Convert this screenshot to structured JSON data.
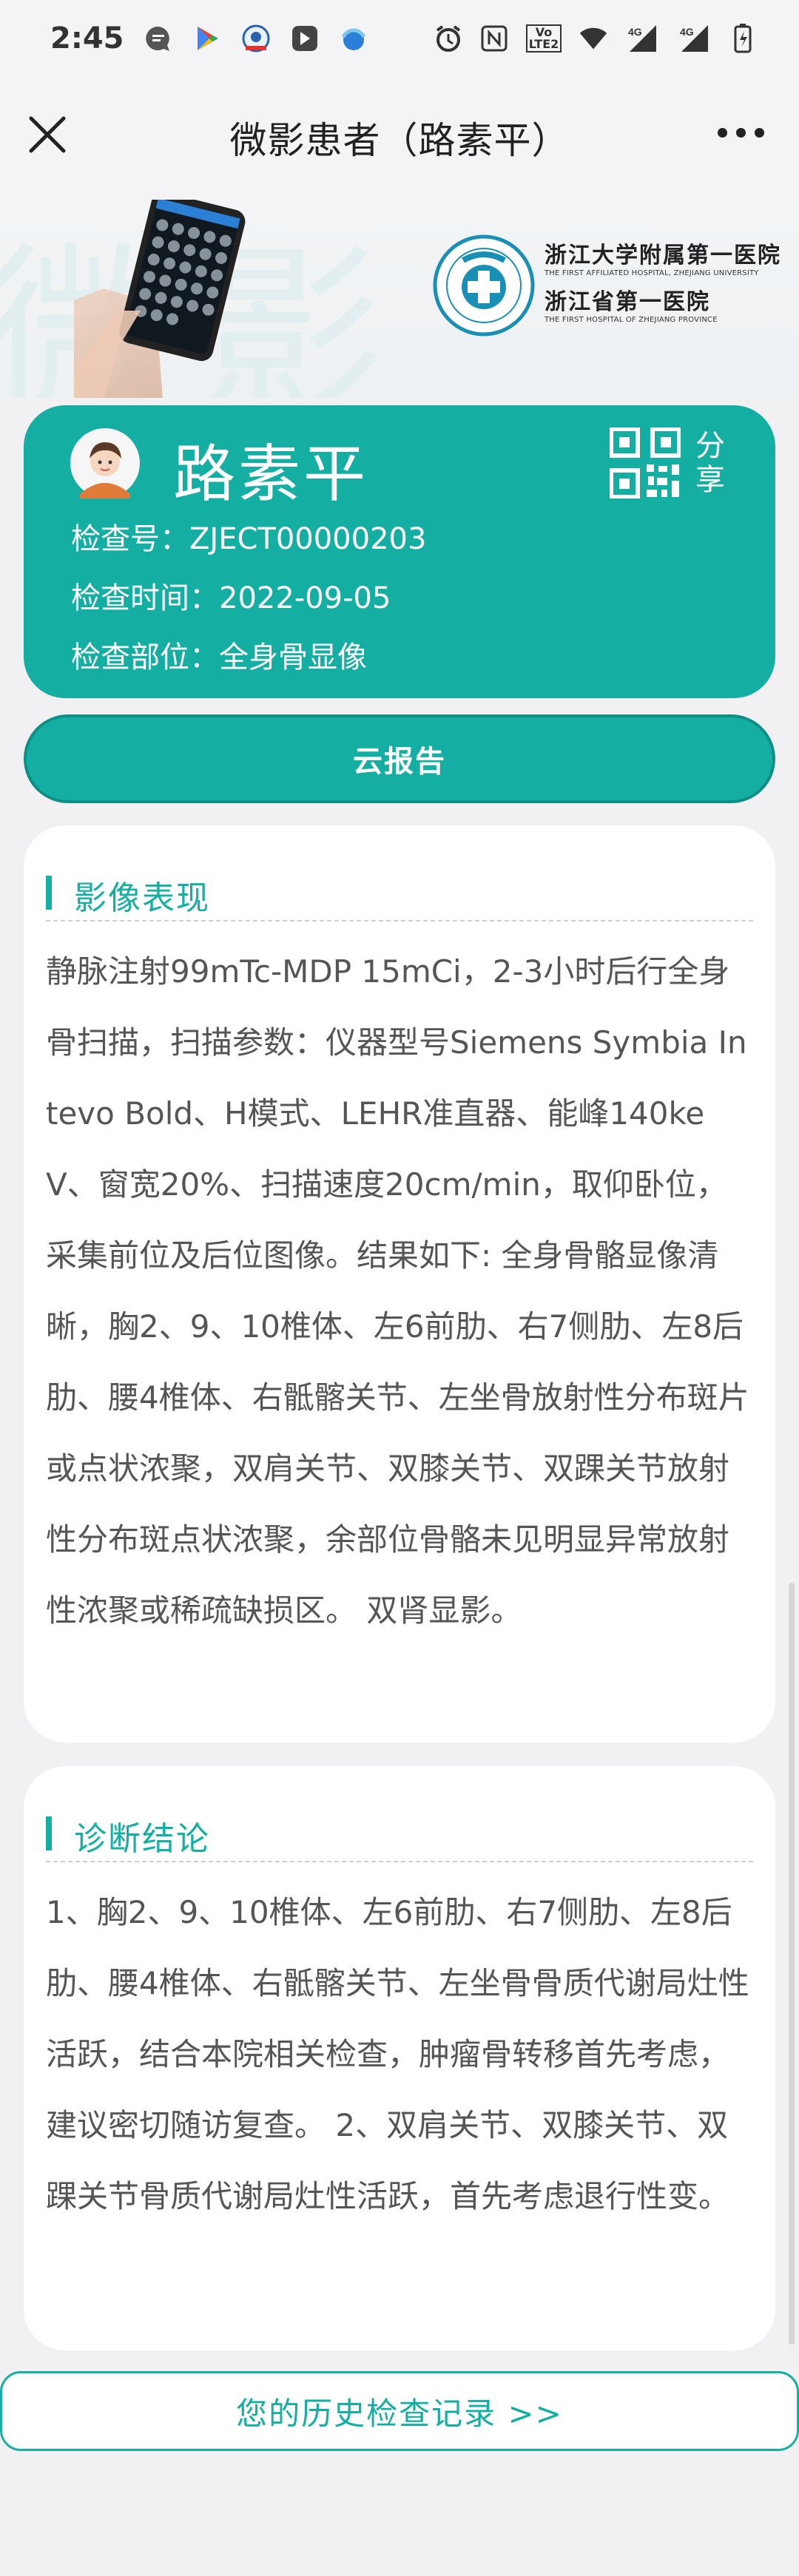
{
  "status_bar": {
    "time": "2:45",
    "volte_label_top": "Vo",
    "volte_label_bottom": "LTE2",
    "net1": "4G",
    "net2": "4G"
  },
  "nav": {
    "title": "微影患者（路素平）"
  },
  "banner": {
    "bg_text": "微影",
    "hospital_name_line1": "浙江大学附属第一医院",
    "hospital_en_line1": "THE FIRST AFFILIATED HOSPITAL, ZHEJIANG UNIVERSITY",
    "hospital_name_line2": "浙江省第一医院",
    "hospital_en_line2": "THE FIRST HOSPITAL OF ZHEJIANG PROVINCE"
  },
  "patient": {
    "name": "路素平",
    "exam_no": "检查号：ZJECT00000203",
    "exam_time": "检查时间：2022-09-05",
    "exam_part": "检查部位：全身骨显像",
    "share_label": "分享"
  },
  "report_button": "云报告",
  "imaging": {
    "title": "影像表现",
    "text": "静脉注射99mTc-MDP 15mCi，2-3小时后行全身骨扫描，扫描参数：仪器型号Siemens Symbia Intevo Bold、H模式、LEHR准直器、能峰140keV、窗宽20%、扫描速度20cm/min，取仰卧位，采集前位及后位图像。结果如下: 全身骨骼显像清晰，胸2、9、10椎体、左6前肋、右7侧肋、左8后肋、腰4椎体、右骶髂关节、左坐骨放射性分布斑片或点状浓聚，双肩关节、双膝关节、双踝关节放射性分布斑点状浓聚，余部位骨骼未见明显异常放射性浓聚或稀疏缺损区。 双肾显影。"
  },
  "diagnosis": {
    "title": "诊断结论",
    "text": "1、胸2、9、10椎体、左6前肋、右7侧肋、左8后肋、腰4椎体、右骶髂关节、左坐骨骨质代谢局灶性活跃，结合本院相关检查，肿瘤骨转移首先考虑，建议密切随访复查。 2、双肩关节、双膝关节、双踝关节骨质代谢局灶性活跃，首先考虑退行性变。"
  },
  "history_button": "您的历史检查记录 >>",
  "colors": {
    "accent": "#15aea3",
    "background": "#f1f1f3"
  },
  "icons": {
    "close": "close-icon",
    "more": "more-icon",
    "qr": "qr-code-icon",
    "avatar": "avatar"
  }
}
